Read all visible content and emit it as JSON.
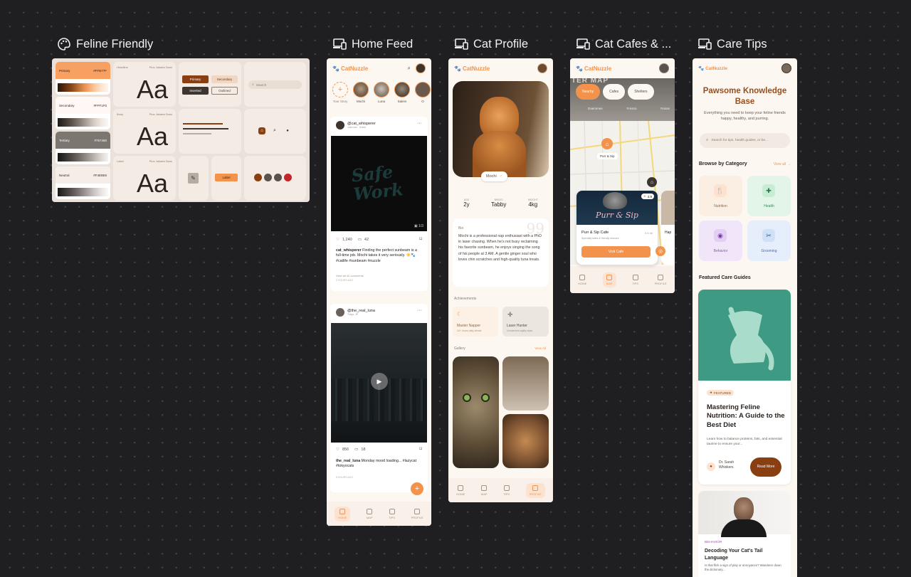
{
  "frames": {
    "design_system": {
      "title": "Feline Friendly",
      "icon": "palette-icon"
    },
    "home_feed": {
      "title": "Home Feed",
      "icon": "devices-icon"
    },
    "cat_profile": {
      "title": "Cat Profile",
      "icon": "devices-icon"
    },
    "cat_cafes": {
      "title": "Cat Cafes & ...",
      "icon": "devices-icon"
    },
    "care_tips": {
      "title": "Care Tips",
      "icon": "devices-icon"
    }
  },
  "design_system": {
    "swatches": [
      {
        "label": "Primary",
        "hex": "#FFB77F"
      },
      {
        "label": "Secondary",
        "hex": "#FFF1F0"
      },
      {
        "label": "Tertiary",
        "hex": "#757460"
      },
      {
        "label": "Neutral",
        "hex": "#F4E8E6"
      }
    ],
    "type_cards": [
      {
        "label": "Headline",
        "sample": "Aa"
      },
      {
        "label": "Body",
        "sample": "Aa"
      },
      {
        "label": "Label",
        "sample": "Aa"
      }
    ],
    "type_font": "Plus Jakarta Sans",
    "buttons": {
      "primary": "Primary",
      "secondary": "Secondary",
      "inverted": "Inverted",
      "outlined": "Outlined"
    },
    "search_placeholder": "Search",
    "label_chip": "Label",
    "colors": {
      "primary": "#f3924a",
      "brown": "#8a3f12",
      "dark": "#3d352f"
    }
  },
  "app": {
    "brand": "CatNuzzle"
  },
  "home_feed": {
    "stories": [
      {
        "name": "Your Story"
      },
      {
        "name": "Mochi"
      },
      {
        "name": "Luna"
      },
      {
        "name": "Salem"
      },
      {
        "name": "O"
      }
    ],
    "posts": [
      {
        "user": "@cat_whisperer",
        "sub": "Just now · Home",
        "video_text": "Safe Work",
        "likes": "1,240",
        "comments": "42",
        "caption_user": "cat_whisperer",
        "caption": "Finding the perfect sunbeam is a full-time job. Mochi takes it very seriously. ☀️🐾 #catlife #sunbeam #nuzzle",
        "view_comments": "View all 42 comments",
        "time": "2 HOURS AGO"
      },
      {
        "user": "@the_real_luna",
        "sub": "Tokyo, JP",
        "likes": "856",
        "comments": "18",
        "caption_user": "the_real_luna",
        "caption": "Monday mood loading... #lazycat #tokyocats",
        "time": "5 HOURS AGO"
      }
    ],
    "nav": [
      "HOME",
      "MAP",
      "TIPS",
      "PROFILE"
    ]
  },
  "cat_profile": {
    "cat_name": "Mochi",
    "stats": [
      {
        "label": "AGE",
        "value": "2y"
      },
      {
        "label": "BREED",
        "value": "Tabby"
      },
      {
        "label": "WEIGHT",
        "value": "4kg"
      }
    ],
    "bio_label": "Bio",
    "bio": "Mochi is a professional nap enthusiast with a PhD in laser chasing. When he's not busy reclaiming his favorite sunbeam, he enjoys singing the song of his people at 3 AM. A gentle ginger soul who loves chin scratches and high-quality tuna treats.",
    "achievements_label": "Achievements",
    "achievements": [
      {
        "title": "Master Napper",
        "sub": "14+ hours daily streak"
      },
      {
        "title": "Laser Hunter",
        "sub": "Unmatched agility stats"
      }
    ],
    "gallery_label": "Gallery",
    "view_all": "View All",
    "nav": [
      "HOME",
      "MAP",
      "TIPS",
      "PROFILE"
    ]
  },
  "cat_cafes": {
    "map_title": "TER MAP",
    "filters": [
      "Nearby",
      "Cafes",
      "Shelters"
    ],
    "districts": [
      "Daemmee",
      "Fresno",
      "Rosse"
    ],
    "pin_label": "Purr & Sip",
    "rating": "4.9",
    "cafe_name": "Purr & Sip Cafe",
    "cafe_distance": "0.4 mi",
    "cafe_desc": "Specialty lattes & friendly rescues",
    "visit_button": "Visit Cafe",
    "second_card": "Hap",
    "nav": [
      "HOME",
      "MAP",
      "TIPS",
      "PROFILE"
    ]
  },
  "care_tips": {
    "title": "Pawsome Knowledge Base",
    "subtitle": "Everything you need to keep your feline friends happy, healthy, and purring.",
    "search_placeholder": "Search for tips, health guides, or be...",
    "browse_label": "Browse by Category",
    "view_all": "View all",
    "categories": [
      {
        "name": "Nutrition",
        "icon": "utensils-icon",
        "color": "#fbeee3"
      },
      {
        "name": "Health",
        "icon": "medkit-icon",
        "color": "#e3f4e9"
      },
      {
        "name": "Behavior",
        "icon": "brain-icon",
        "color": "#f1e6f9"
      },
      {
        "name": "Grooming",
        "icon": "scissors-icon",
        "color": "#e6eefb"
      }
    ],
    "featured_label": "Featured Care Guides",
    "featured": {
      "badge": "FEATURED",
      "title": "Mastering Feline Nutrition: A Guide to the Best Diet",
      "desc": "Learn how to balance proteins, fats, and essential taurine to ensure your...",
      "author": "Dr. Sarah Whiskers",
      "read_more": "Read More"
    },
    "second": {
      "badge": "BEHAVIOR",
      "title": "Decoding Your Cat's Tail Language",
      "desc": "Is that flick a sign of play or annoyance? Wanderer down the dictionary..."
    }
  }
}
